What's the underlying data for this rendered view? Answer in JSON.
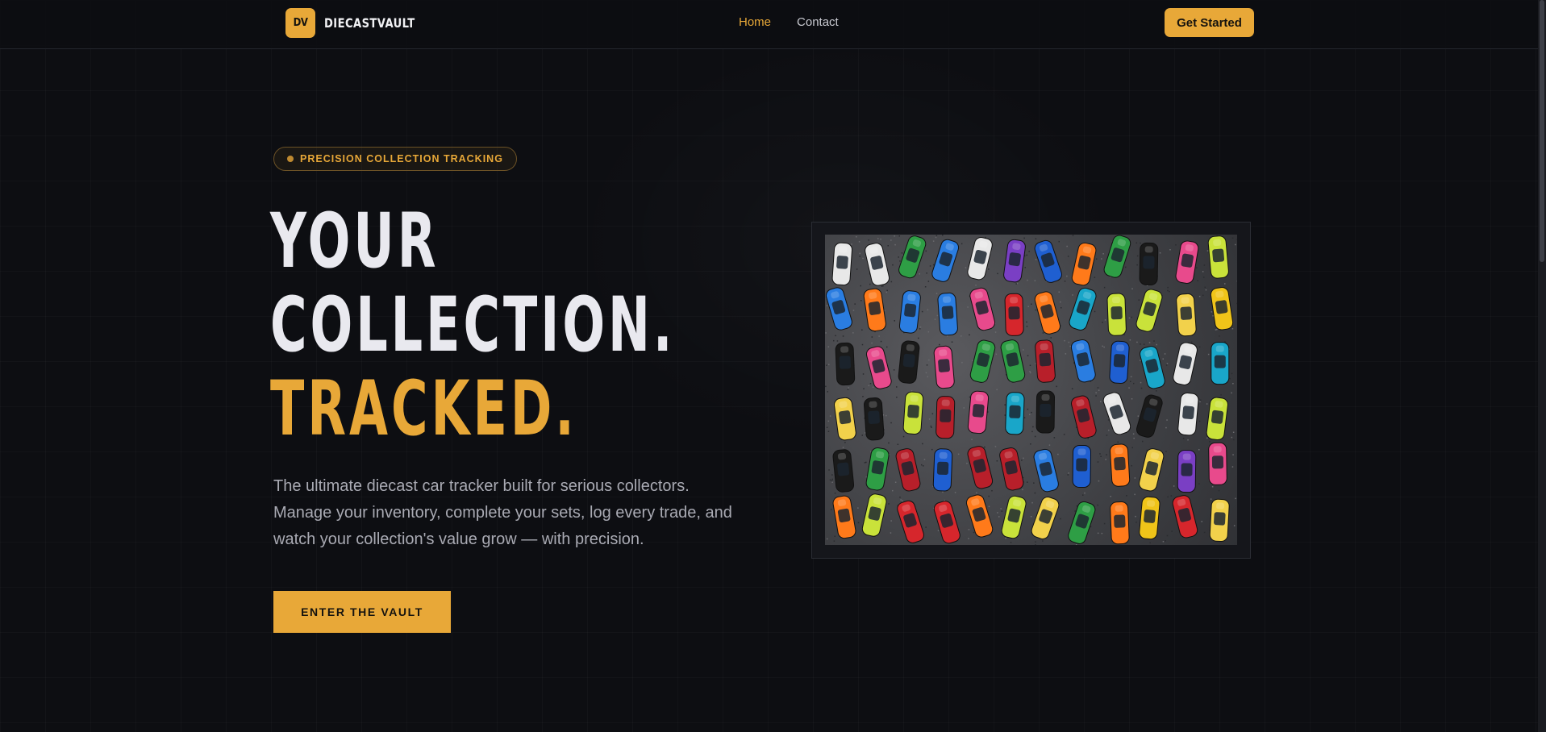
{
  "nav": {
    "logo_mark": "DV",
    "brand": "DIECASTVAULT",
    "links": [
      "Home",
      "Contact"
    ],
    "cta": "Get Started"
  },
  "hero": {
    "badge": "PRECISION COLLECTION TRACKING",
    "headline": [
      "YOUR",
      "COLLECTION.",
      "TRACKED."
    ],
    "subtitle": "The ultimate diecast car tracker built for serious collectors. Manage your inventory, complete your sets, log every trade, and watch your collection's value grow — with precision.",
    "primary_cta": "ENTER THE VAULT"
  },
  "colors": {
    "accent": "#e8a838",
    "background": "#0d0e12",
    "text": "#e9e9ef",
    "muted": "#a9aab3"
  },
  "image": {
    "subject": "overhead-view-of-many-colorful-diecast-toy-cars-on-asphalt"
  }
}
